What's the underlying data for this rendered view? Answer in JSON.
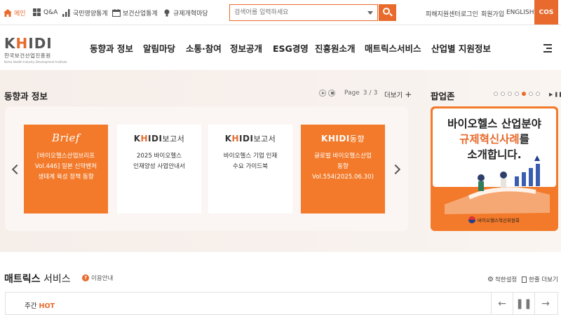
{
  "utility_nav": [
    {
      "label": "메인",
      "icon": "home-icon"
    },
    {
      "label": "Q&A",
      "icon": "grid-icon"
    },
    {
      "label": "국민영양통계",
      "icon": "bar-chart-icon"
    },
    {
      "label": "보건산업통계",
      "icon": "calendar-icon"
    },
    {
      "label": "규제개혁마당",
      "icon": "lightbulb-icon"
    }
  ],
  "search": {
    "placeholder": "검색어를 입력하세요",
    "icon": "search-icon"
  },
  "top_links": [
    "피해지원센터",
    "로그인",
    "회원가입",
    "ENGLISH"
  ],
  "cos_label": "COS",
  "logo": {
    "mark_prefix": "K",
    "mark_hl": "H",
    "mark_suffix": "IDI",
    "korean": "한국보건산업진흥원",
    "english": "Korea Health Industry Development Institute"
  },
  "main_nav": [
    "동향과 정보",
    "알림마당",
    "소통·참여",
    "정보공개",
    "ESG경영",
    "진흥원소개",
    "매트릭스서비스",
    "산업별 지원정보"
  ],
  "trends": {
    "title": "동향과 정보",
    "page_label": "Page",
    "page_current": "3",
    "page_sep": "/",
    "page_total": "3",
    "more": "더보기",
    "cards": [
      {
        "brand": "Brief",
        "line1": "[바이오헬스산업브리프",
        "line2": "Vol.446] 일본 신약벤처",
        "line3": "생태계 육성 정책 동향"
      },
      {
        "brand_prefix": "K",
        "brand_hl": "H",
        "brand_suffix": "IDI",
        "brand_tail": "보고서",
        "line1": "2025 바이오헬스",
        "line2": "인재양성 사업안내서"
      },
      {
        "brand_prefix": "K",
        "brand_hl": "H",
        "brand_suffix": "IDI",
        "brand_tail": "보고서",
        "line1": "바이오헬스 기업 인재",
        "line2": "수요 가이드북"
      },
      {
        "brand_prefix": "K",
        "brand_hl": "H",
        "brand_suffix": "IDI",
        "brand_tail": "동향",
        "line1": "글로벌 바이오헬스산업",
        "line2": "동향 Vol.554(2025.06.30)"
      }
    ]
  },
  "popup_zone": {
    "title": "팝업존",
    "dot_count": 7,
    "active_dot": 5,
    "line1": "바이오헬스 산업분야",
    "line2_hl": "규제혁신사례",
    "line2_tail": "를",
    "line3": "소개합니다.",
    "seal": "바이오헬스혁신위원회"
  },
  "matrix": {
    "title_bold": "매트릭스",
    "title_rest": " 서비스",
    "info": "이용안내",
    "settings": "착한설정",
    "view_all": "한줄 더보기",
    "tab_label": "주간",
    "tab_hot": "HOT"
  }
}
